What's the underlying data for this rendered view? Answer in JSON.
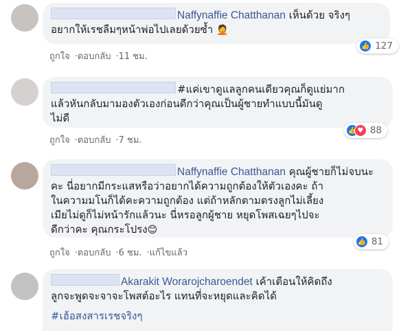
{
  "comments": [
    {
      "name": "Naffynaffie Chatthanan",
      "text_l1": " เห็นด้วย จริงๆ",
      "text_l2": "อยากให้เรชลืมๆหน้าพ่อไปเลยด้วยซ้ำ",
      "emoji": "🤦",
      "like_label": "ถูกใจ",
      "reply_label": "ตอบกลับ",
      "time": "11 ชม.",
      "reaction_count": "127"
    },
    {
      "text_l1": "#แค่เขาดูแลลูกคนเดียวคุณก็ดูแย่มาก",
      "text_l2": "แล้วหันกลับมามองตัวเองก่อนดีกว่าคุณเป็นผู้ชายทำแบบนี้มันดู",
      "text_l3": "ไม่ดี",
      "like_label": "ถูกใจ",
      "reply_label": "ตอบกลับ",
      "time": "7 ชม.",
      "reaction_count": "88"
    },
    {
      "name": "Naffynaffie Chatthanan",
      "text_l1": " คุณผู้ชายก็ไม่จบนะ",
      "text_l2": "คะ นี่อยากมีกระแสหรือว่าอยากได้ความถูกต้องให้ตัวเองคะ ถ้า",
      "text_l3": "ในความมโนก็ได้คะความถูกต้อง แต่ถ้าหลักตามตรงลูกไม่เลี้ยง",
      "text_l4": "เมียไม่ดูก็ไม่หน้ารักแล้วนะ นี่หรอลูกผู้ชาย หยุดโพสเฉยๆไปจะ",
      "text_l5": "ดีกว่าคะ คุณกระโปรง",
      "emoji": "😊",
      "like_label": "ถูกใจ",
      "reply_label": "ตอบกลับ",
      "time": "6 ชม.",
      "edited_label": "แก้ไขแล้ว",
      "reaction_count": "81"
    },
    {
      "name": "Akarakit Worarojcharoendet",
      "text_l1": " เค้าเตือนให้คิดถึง",
      "text_l2": "ลูกจะพูดจะจาจะโพสต์อะไร แทนที่จะหยุดและคิดได้",
      "hashtag": "#เฮ้อสงสารเรชจริงๆ"
    }
  ],
  "colors": {
    "name_link": "#385898",
    "bubble_bg": "#f2f3f5",
    "like_blue": "#1877f2",
    "love_red": "#f33e58"
  },
  "icons": [
    "like-icon",
    "love-icon"
  ]
}
